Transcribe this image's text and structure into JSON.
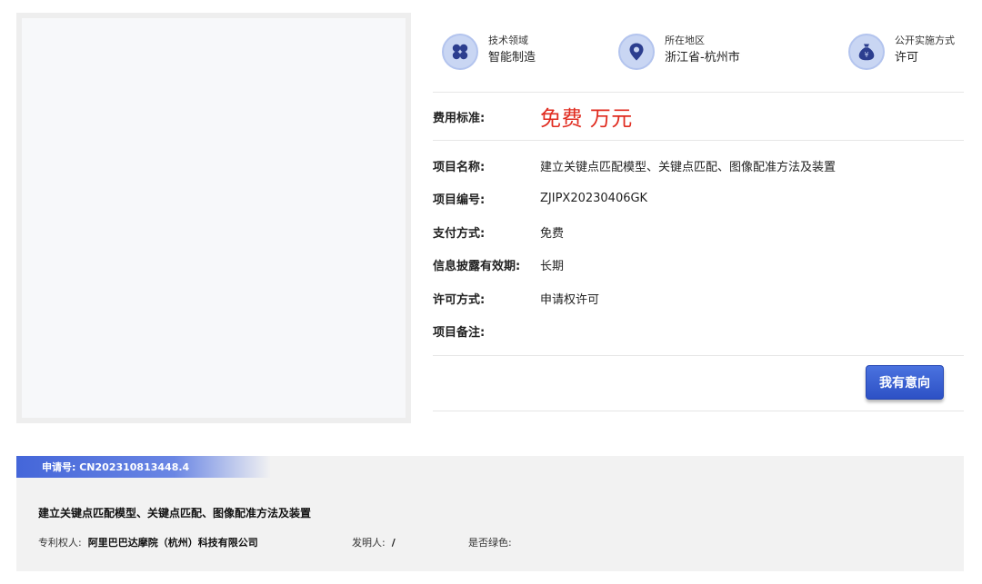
{
  "attributes": [
    {
      "label": "技术领域",
      "value": "智能制造",
      "icon": "grid-icon"
    },
    {
      "label": "所在地区",
      "value": "浙江省-杭州市",
      "icon": "location-pin-icon"
    },
    {
      "label": "公开实施方式",
      "value": "许可",
      "icon": "money-bag-icon"
    }
  ],
  "fee": {
    "label": "费用标准:",
    "value": "免费 万元"
  },
  "details": [
    {
      "label": "项目名称:",
      "value": "建立关键点匹配模型、关键点匹配、图像配准方法及装置"
    },
    {
      "label": "项目编号:",
      "value": "ZJIPX20230406GK"
    },
    {
      "label": "支付方式:",
      "value": "免费"
    },
    {
      "label": "信息披露有效期:",
      "value": "长期"
    },
    {
      "label": "许可方式:",
      "value": "申请权许可"
    },
    {
      "label": "项目备注:",
      "value": ""
    }
  ],
  "action": {
    "intent_label": "我有意向"
  },
  "patent": {
    "application_no": "申请号: CN202310813448.4",
    "title": "建立关键点匹配模型、关键点匹配、图像配准方法及装置",
    "holder_label": "专利权人:",
    "holder_value": "阿里巴巴达摩院（杭州）科技有限公司",
    "inventor_label": "发明人:",
    "inventor_value": "/",
    "green_label": "是否绿色:",
    "green_value": ""
  },
  "colors": {
    "accent": "#3558cf",
    "fee_red": "#e02b1f",
    "icon_bg": "#c9d6f3"
  }
}
